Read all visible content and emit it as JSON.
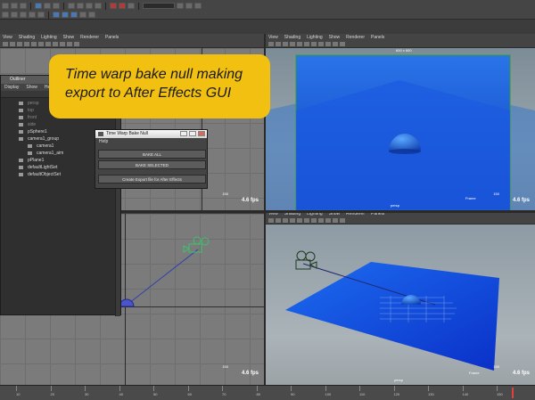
{
  "viewport_menu": [
    "View",
    "Shading",
    "Lighting",
    "Show",
    "Renderer",
    "Panels"
  ],
  "viewports": {
    "top_left": {
      "fps": "4.6 fps",
      "frame": "150"
    },
    "top_right": {
      "fps": "4.6 fps",
      "frame": "150",
      "resolution": "600 x 600",
      "label_bottom": "persp",
      "label_right": "Frame"
    },
    "bottom_left": {
      "fps": "4.6 fps",
      "frame": "150"
    },
    "bottom_right": {
      "fps": "4.6 fps",
      "frame": "150",
      "label_bottom": "persp",
      "label_right": "Frame"
    }
  },
  "outliner": {
    "title": "Outliner",
    "menu": [
      "Display",
      "Show",
      "Help"
    ],
    "items": [
      {
        "label": "persp",
        "dim": true,
        "indent": false
      },
      {
        "label": "top",
        "dim": true,
        "indent": false
      },
      {
        "label": "front",
        "dim": true,
        "indent": false
      },
      {
        "label": "side",
        "dim": true,
        "indent": false
      },
      {
        "label": "pSphere1",
        "dim": false,
        "indent": false
      },
      {
        "label": "camera1_group",
        "dim": false,
        "indent": false
      },
      {
        "label": "camera1",
        "dim": false,
        "indent": true
      },
      {
        "label": "camera1_aim",
        "dim": false,
        "indent": true
      },
      {
        "label": "pPlane1",
        "dim": false,
        "indent": false
      },
      {
        "label": "defaultLightSet",
        "dim": false,
        "indent": false
      },
      {
        "label": "defaultObjectSet",
        "dim": false,
        "indent": false
      }
    ]
  },
  "dialog": {
    "title": "Time Warp Bake Null",
    "menu": "Help",
    "buttons": [
      "BAKE ALL",
      "BAKE SELECTED",
      "Create Export file for After Effects"
    ]
  },
  "callout": {
    "line1": "Time warp bake  null making",
    "line2": "export to After Effects GUI"
  },
  "timeline": {
    "ticks": [
      "10",
      "20",
      "30",
      "40",
      "50",
      "60",
      "70",
      "80",
      "90",
      "100",
      "110",
      "120",
      "130",
      "140",
      "150"
    ]
  },
  "colors": {
    "accent": "#f2c010",
    "plane_blue": "#1c5be0",
    "viewport_grey": "#7b7b7b"
  }
}
